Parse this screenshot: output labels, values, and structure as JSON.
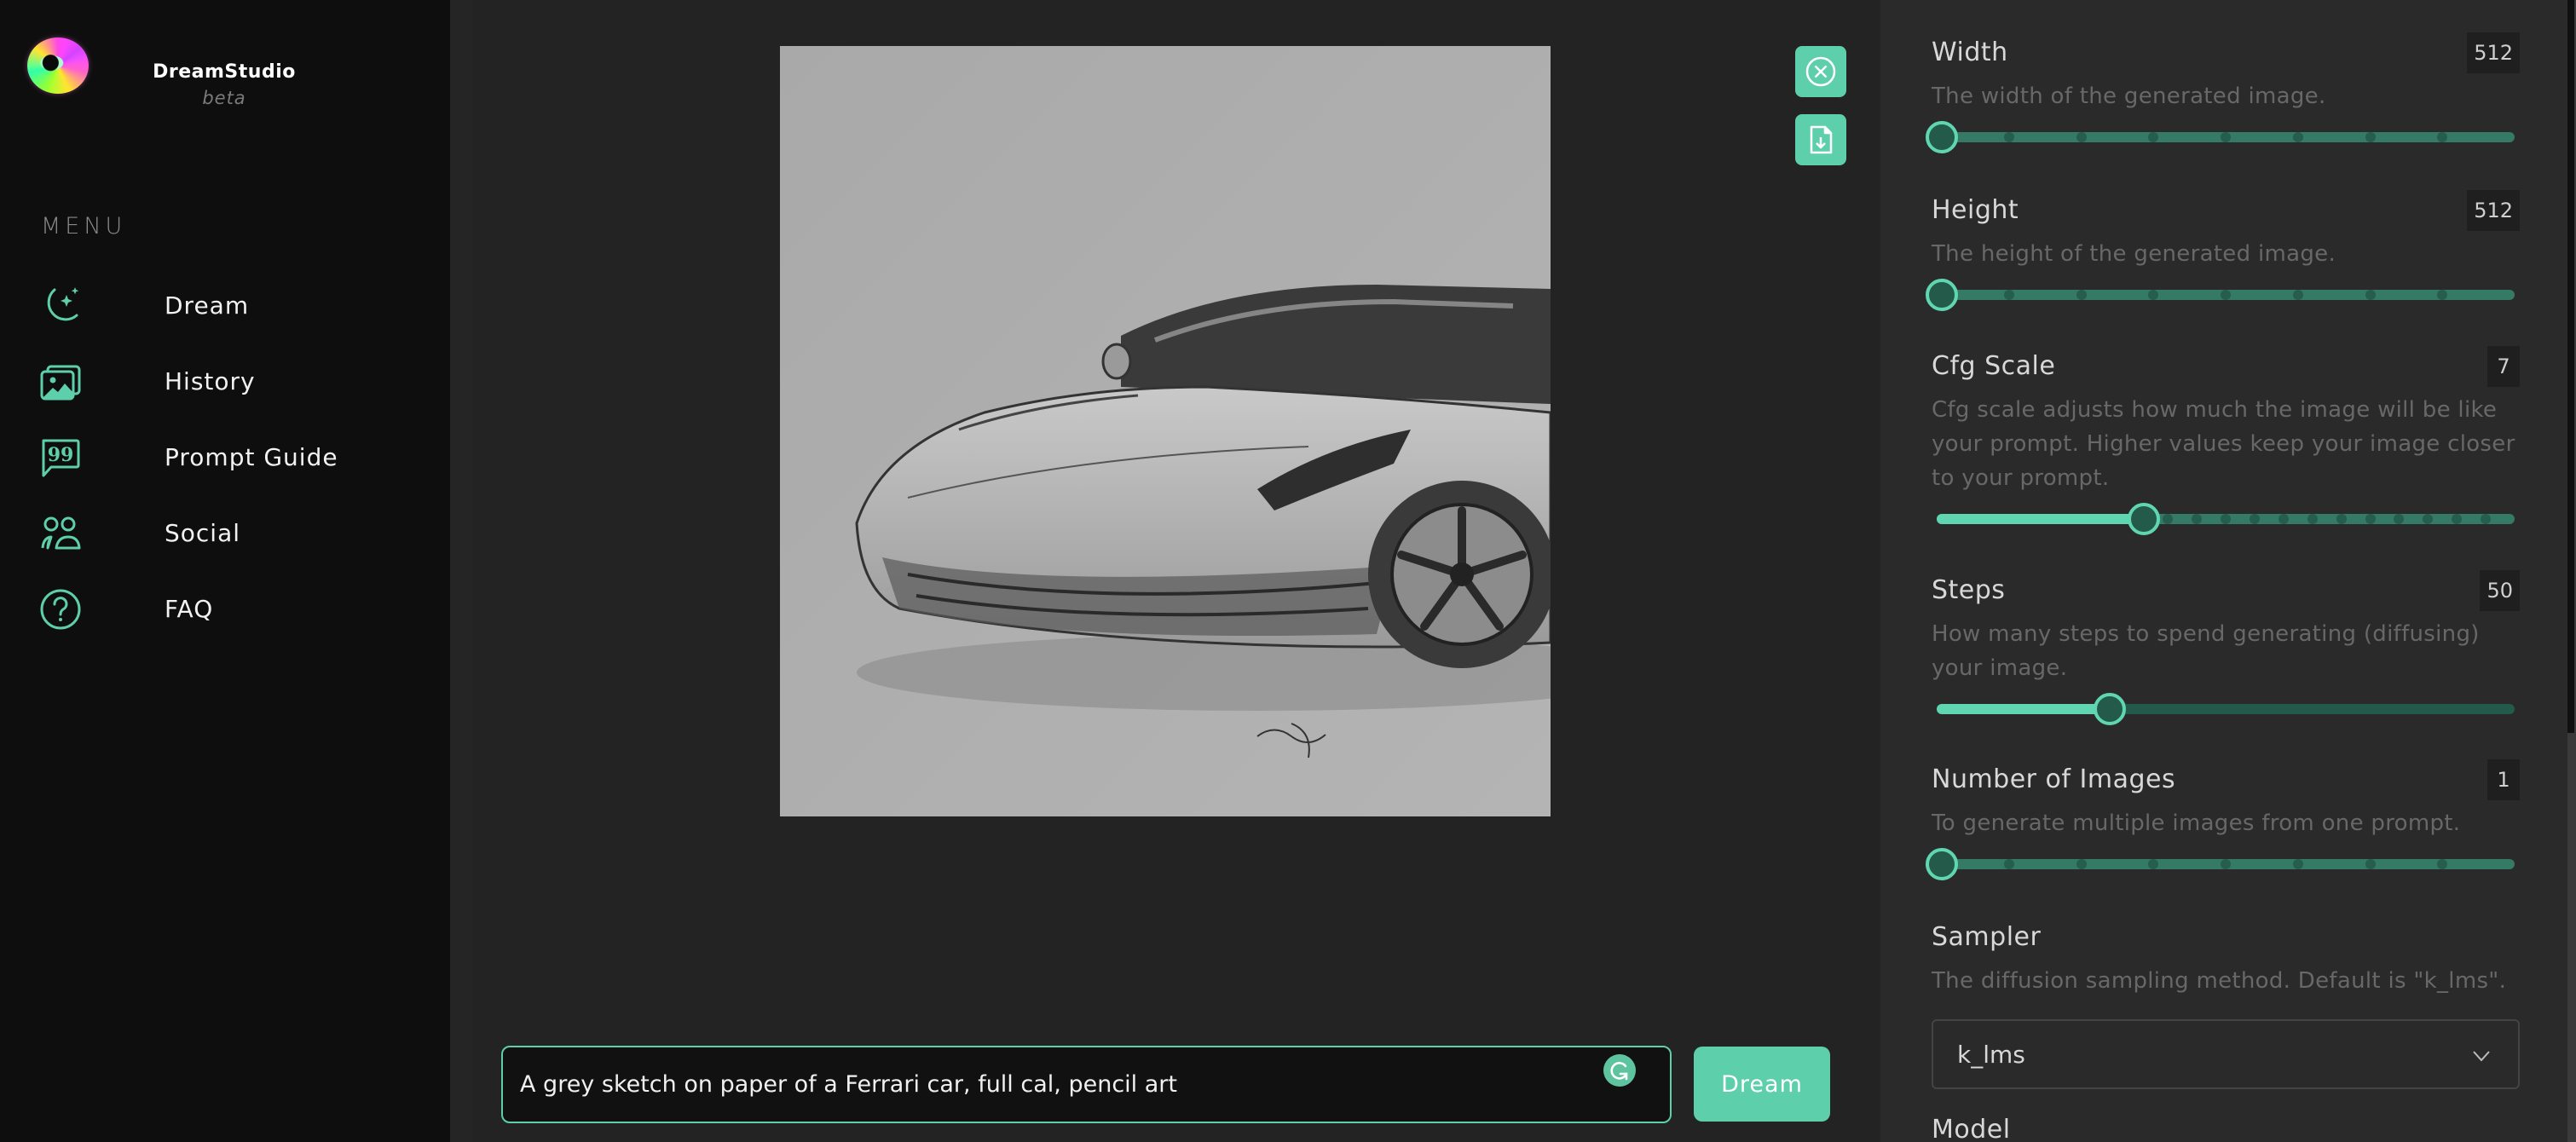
{
  "app": {
    "name": "DreamStudio",
    "tag": "beta"
  },
  "sidebar": {
    "menu_label": "MENU",
    "items": [
      {
        "label": "Dream",
        "icon": "moon-stars-icon"
      },
      {
        "label": "History",
        "icon": "images-icon"
      },
      {
        "label": "Prompt Guide",
        "icon": "quote-bubble-icon"
      },
      {
        "label": "Social",
        "icon": "users-icon"
      },
      {
        "label": "FAQ",
        "icon": "question-circle-icon"
      }
    ]
  },
  "main": {
    "image": {
      "alt": "Grey pencil sketch of a Ferrari sports car on paper"
    },
    "actions": {
      "close_icon": "close-circle-icon",
      "download_icon": "file-download-icon"
    },
    "prompt": {
      "value": "A grey sketch on paper of a Ferrari car, full cal, pencil art",
      "placeholder": ""
    },
    "dream_button": "Dream"
  },
  "settings": {
    "width": {
      "title": "Width",
      "value": "512",
      "description": "The width of the generated image.",
      "fraction": 0,
      "ticks": 8
    },
    "height": {
      "title": "Height",
      "value": "512",
      "description": "The height of the generated image.",
      "fraction": 0,
      "ticks": 8
    },
    "cfg_scale": {
      "title": "Cfg Scale",
      "value": "7",
      "description": "Cfg scale adjusts how much the image will be like your prompt. Higher values keep your image closer to your prompt.",
      "fraction": 0.35,
      "ticks": 20
    },
    "steps": {
      "title": "Steps",
      "value": "50",
      "description": "How many steps to spend generating (diffusing) your image.",
      "fraction": 0.29,
      "ticks": 0
    },
    "num_images": {
      "title": "Number of Images",
      "value": "1",
      "description": "To generate multiple images from one prompt.",
      "fraction": 0,
      "ticks": 8
    },
    "sampler": {
      "title": "Sampler",
      "description": "The diffusion sampling method. Default is \"k_lms\".",
      "selected": "k_lms"
    },
    "model": {
      "title": "Model"
    }
  },
  "colors": {
    "accent": "#5ecfab",
    "sidebar_bg": "#0e0e0e",
    "main_bg": "#232323",
    "panel_bg": "#2a2a2a",
    "slider_track": "#347a65",
    "slider_thumb": "#245a49"
  }
}
